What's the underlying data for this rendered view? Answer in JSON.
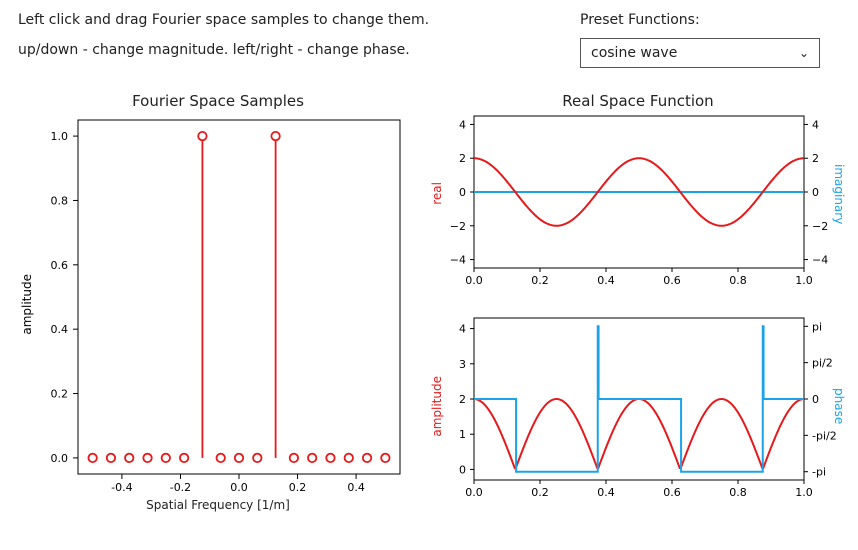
{
  "instructions": {
    "line1": "Left click and drag Fourier space samples to change them.",
    "line2": "up/down - change magnitude. left/right - change phase."
  },
  "preset": {
    "label": "Preset Functions:",
    "selected": "cosine wave"
  },
  "colors": {
    "real": "#e41a1c",
    "imag": "#1aa3e8",
    "axis": "#000"
  },
  "chart_data": [
    {
      "type": "scatter",
      "title": "Fourier Space Samples",
      "xlabel": "Spatial Frequency [1/m]",
      "ylabel": "amplitude",
      "xlim": [
        -0.55,
        0.55
      ],
      "ylim": [
        -0.05,
        1.05
      ],
      "xticks": [
        -0.4,
        -0.2,
        0.0,
        0.2,
        0.4
      ],
      "yticks": [
        0.0,
        0.2,
        0.4,
        0.6,
        0.8,
        1.0
      ],
      "x": [
        -0.5,
        -0.4375,
        -0.375,
        -0.3125,
        -0.25,
        -0.1875,
        -0.125,
        -0.0625,
        0.0,
        0.0625,
        0.125,
        0.1875,
        0.25,
        0.3125,
        0.375,
        0.4375,
        0.5
      ],
      "values": [
        0,
        0,
        0,
        0,
        0,
        0,
        1.0,
        0,
        0,
        0,
        1.0,
        0,
        0,
        0,
        0,
        0,
        0
      ]
    },
    {
      "type": "line",
      "title": "Real Space Function",
      "xlim": [
        0.0,
        1.0
      ],
      "ylim": [
        -4.5,
        4.5
      ],
      "xticks": [
        0.0,
        0.2,
        0.4,
        0.6,
        0.8,
        1.0
      ],
      "yticks_left": [
        -4,
        -2,
        0,
        2,
        4
      ],
      "yticks_right": [
        -4,
        -2,
        0,
        2,
        4
      ],
      "ylabel_left": "real",
      "ylabel_right": "imaginary",
      "series": [
        {
          "name": "real",
          "fn": "2cos(4pi x)",
          "amplitude": 2,
          "freq_cycles": 2
        },
        {
          "name": "imag",
          "fn": "0"
        }
      ]
    },
    {
      "type": "line",
      "xlim": [
        0.0,
        1.0
      ],
      "ylim_left": [
        -0.3,
        4.3
      ],
      "ylim_right": [
        -3.5,
        3.5
      ],
      "xticks": [
        0.0,
        0.2,
        0.4,
        0.6,
        0.8,
        1.0
      ],
      "yticks_left": [
        0,
        1,
        2,
        3,
        4
      ],
      "yticks_right_labels": [
        "-pi",
        "-pi/2",
        "0",
        "pi/2",
        "pi"
      ],
      "ylabel_left": "amplitude",
      "ylabel_right": "phase",
      "series": [
        {
          "name": "amplitude",
          "fn": "|2cos(4pi x)|"
        },
        {
          "name": "phase",
          "fn": "arg(2cos(4pi x))",
          "values_desc": "0 when cos>=0, pi/-pi when cos<0"
        }
      ]
    }
  ]
}
